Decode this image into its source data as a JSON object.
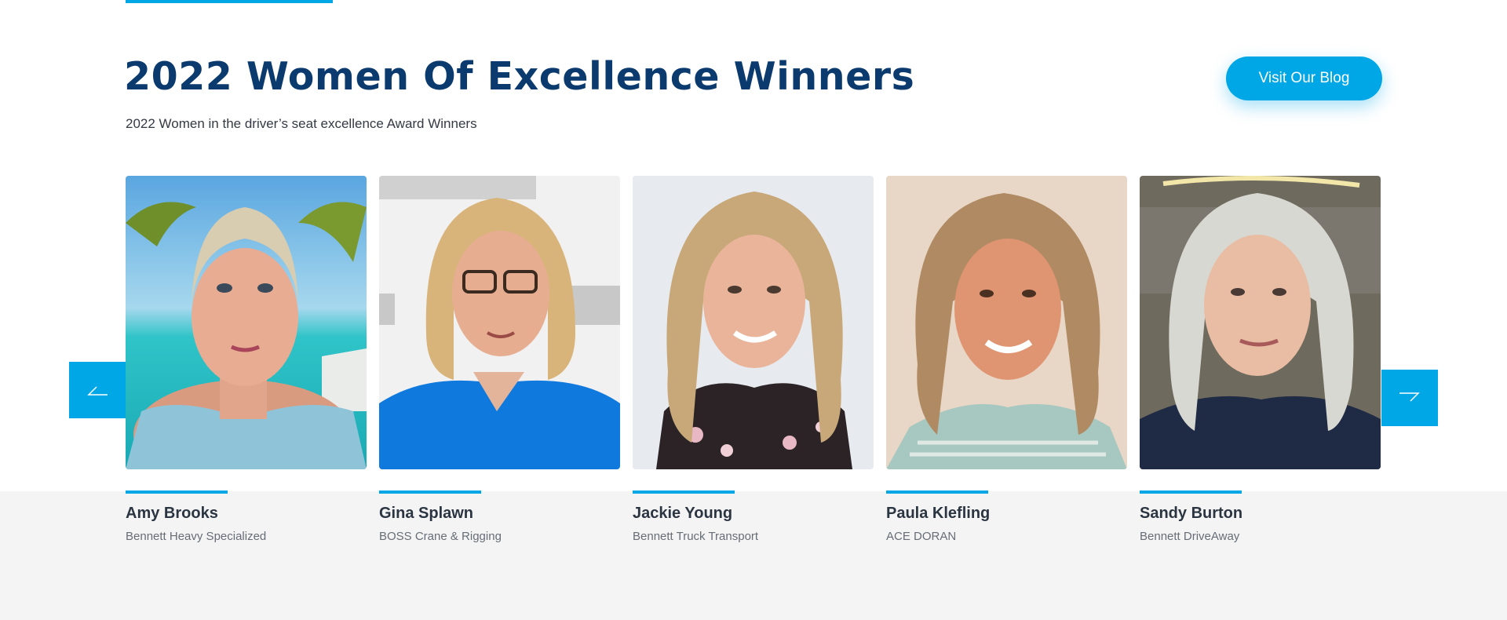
{
  "section": {
    "title": "2022 Women Of Excellence Winners",
    "subtitle": "2022 Women in the driver’s seat excellence Award Winners",
    "blog_button": "Visit Our Blog"
  },
  "carousel": {
    "prev_icon": "arrow-left-icon",
    "next_icon": "arrow-right-icon",
    "winners": [
      {
        "name": "Amy Brooks",
        "company": "Bennett Heavy Specialized",
        "photo": "portrait-photo"
      },
      {
        "name": "Gina Splawn",
        "company": "BOSS Crane & Rigging",
        "photo": "portrait-photo"
      },
      {
        "name": "Jackie Young",
        "company": "Bennett Truck Transport",
        "photo": "portrait-photo"
      },
      {
        "name": "Paula Klefling",
        "company": "ACE DORAN",
        "photo": "portrait-photo"
      },
      {
        "name": "Sandy Burton",
        "company": "Bennett DriveAway",
        "photo": "portrait-photo"
      }
    ]
  },
  "colors": {
    "accent": "#00a7e7",
    "title": "#0b3b6e",
    "band": "#f4f4f4"
  }
}
